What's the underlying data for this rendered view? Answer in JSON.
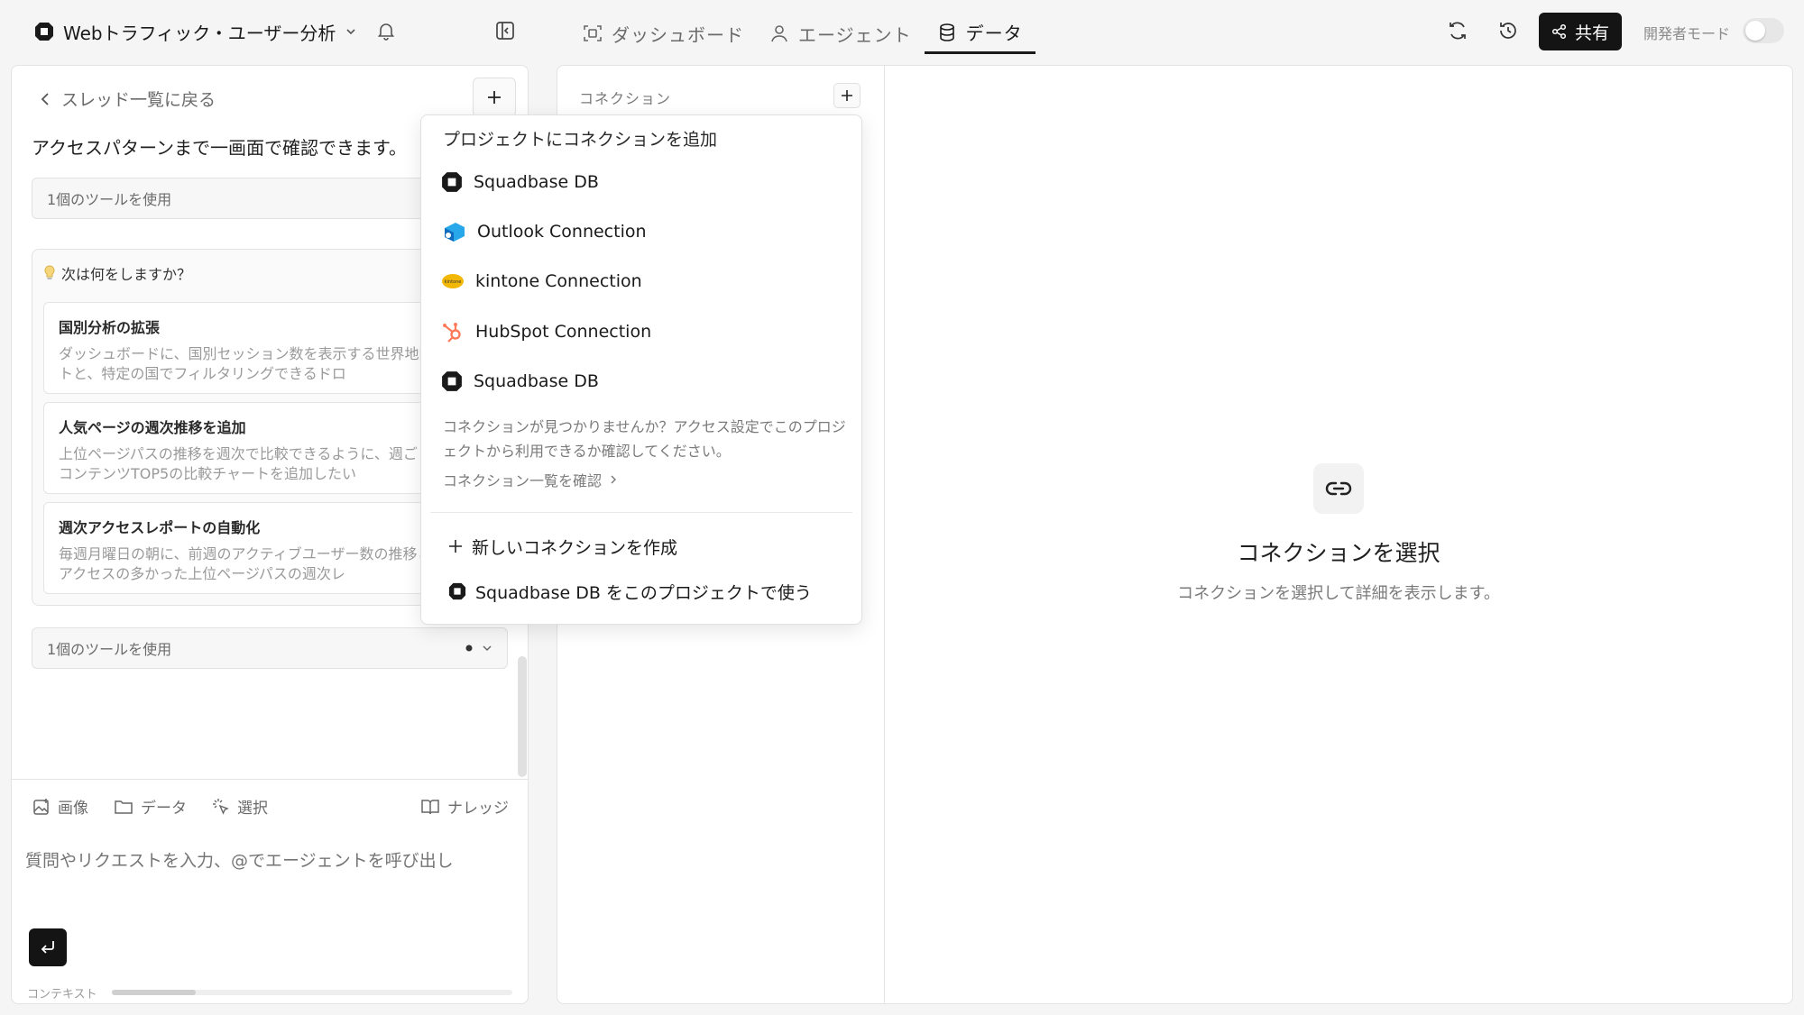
{
  "header": {
    "project_name": "Webトラフィック・ユーザー分析",
    "tabs": [
      {
        "label": "ダッシュボード"
      },
      {
        "label": "エージェント"
      },
      {
        "label": "データ"
      }
    ],
    "share_label": "共有",
    "dev_mode_label": "開発者モード"
  },
  "chat": {
    "back_label": "スレッド一覧に戻る",
    "message_text": "アクセスパターンまで一画面で確認できます。",
    "tool_usage_1": "1個のツールを使用",
    "tool_usage_2": "1個のツールを使用",
    "next_title": "次は何をしますか？",
    "suggestions": [
      {
        "title": "国別分析の拡張",
        "desc": "ダッシュボードに、国別セッション数を表示する世界地図チャートと、特定の国でフィルタリングできるドロ"
      },
      {
        "title": "人気ページの週次推移を追加",
        "desc": "上位ページパスの推移を週次で比較できるように、週ごとの人気コンテンツTOP5の比較チャートを追加したい"
      },
      {
        "title": "週次アクセスレポートの自動化",
        "desc": "毎週月曜日の朝に、前週のアクティブユーザー数の推移と、最もアクセスの多かった上位ページパスの週次レ"
      }
    ],
    "input_tools": [
      {
        "label": "画像"
      },
      {
        "label": "データ"
      },
      {
        "label": "選択"
      }
    ],
    "knowledge_label": "ナレッジ",
    "input_placeholder": "質問やリクエストを入力、@でエージェントを呼び出し",
    "context_label": "コンテキスト",
    "context_usage": 0.21
  },
  "connections": {
    "header": "コネクション",
    "empty_title": "コネクションを選択",
    "empty_subtitle": "コネクションを選択して詳細を表示します。"
  },
  "dropdown": {
    "title": "プロジェクトにコネクションを追加",
    "items": [
      {
        "label": "Squadbase DB",
        "icon": "squadbase-icon"
      },
      {
        "label": "Outlook Connection",
        "icon": "outlook-icon"
      },
      {
        "label": "kintone Connection",
        "icon": "kintone-icon"
      },
      {
        "label": "HubSpot Connection",
        "icon": "hubspot-icon"
      },
      {
        "label": "Squadbase DB",
        "icon": "squadbase-icon"
      }
    ],
    "note": "コネクションが見つかりませんか？アクセス設定でこのプロジェクトから利用できるか確認してください。",
    "link_label": "コネクション一覧を確認",
    "create_label": "新しいコネクションを作成",
    "use_label": "Squadbase DB をこのプロジェクトで使う"
  },
  "colors": {
    "accent_dark": "#141414",
    "hubspot": "#ff7a59",
    "kintone": "#f2b705",
    "outlook": "#0f6cbd"
  }
}
